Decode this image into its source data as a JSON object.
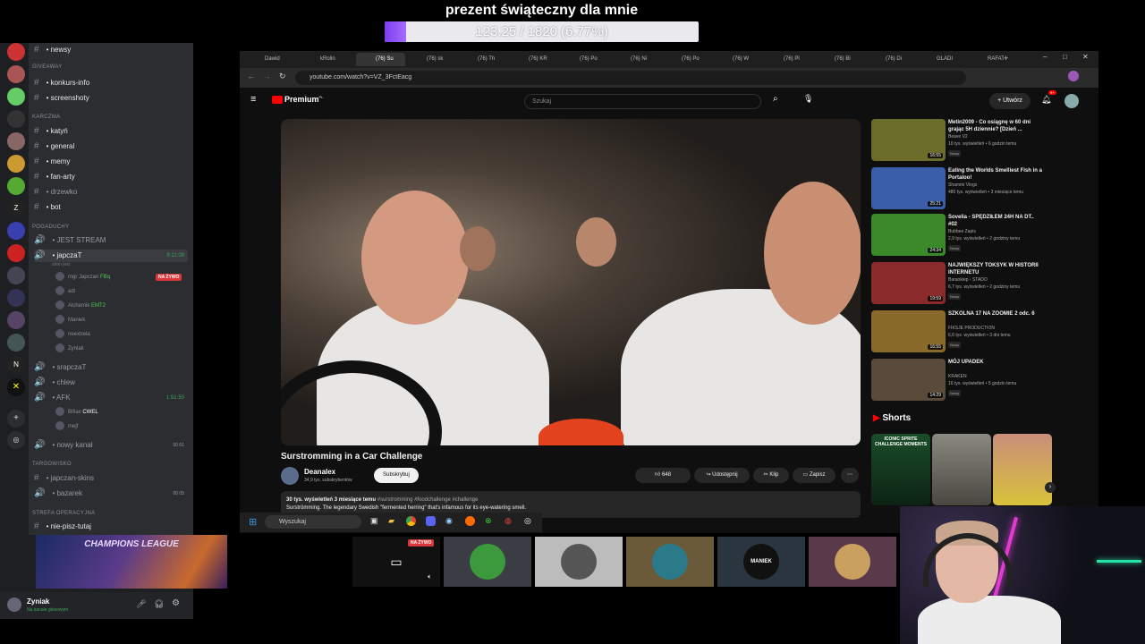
{
  "goal": {
    "title": "prezent świąteczny dla mnie",
    "progress_text": "123.25 / 1820 (6.77%)",
    "progress_fraction": 0.0677
  },
  "discord": {
    "categories": {
      "giveaway": "GIVEAWAY",
      "karczma": "KARCZMA",
      "pogaduchy": "POGADUCHY",
      "targowisko": "TARGOWISKO",
      "strefa": "STREFA OPERACYJNA"
    },
    "channels": {
      "newsy": "newsy",
      "konkurs": "konkurs-info",
      "screenshoty": "screenshoty",
      "katyn": "katyń",
      "general": "general",
      "memy": "memy",
      "fanarty": "fan-arty",
      "drzewko": "drzewko",
      "bot": "bot",
      "jest_stream": "JEST STREAM",
      "japczat": "japczaT",
      "japczat_time": "9:11:09",
      "japczat_sub": "strim jest",
      "srapczat": "srapczaT",
      "chlew": "chlew",
      "afk": "AFK",
      "afk_time": "1:51:50",
      "nowy_kanal": "nowy kanał",
      "japczan_skins": "japczan-skins",
      "bazarek": "bazarek",
      "nie_pisz": "nie-pisz-tutaj"
    },
    "voice_users": [
      "mgr Japczan",
      "adi",
      "Alchemik",
      "Maniek",
      "neextrela",
      "Zynlak"
    ],
    "afk_users": [
      "Bifiax",
      "mejf"
    ],
    "live_badge": "NA ŻYWO",
    "user_tags": {
      "mgr_japczan": "FBq",
      "alchemik": "EMT2",
      "bifiax": "CWEL"
    },
    "counters": {
      "nowy_kanal": "00 01",
      "bazarek": "00 05"
    },
    "banner_text": "CHAMPIONS LEAGUE",
    "current_user": {
      "name": "Zyniak",
      "status": "Na kanale głosowym"
    }
  },
  "browser": {
    "tabs": [
      "Dawid",
      "kRolin",
      "(76) Su",
      "(76) sk",
      "(76) Th",
      "(76) KR",
      "(76) Po",
      "(76) Ni",
      "(76) Po",
      "(76) W",
      "(76) Pl",
      "(76) Bi",
      "(76) Di",
      "GLADI",
      "RAFAT"
    ],
    "url": "youtube.com/watch?v=VZ_3FctEacg",
    "yt_logo": "Premium",
    "yt_logo_sup": "PL",
    "search_placeholder": "Szukaj",
    "create_label": "Utwórz",
    "notif_count": "9+"
  },
  "video": {
    "title": "Surstromming in a Car Challenge",
    "channel": "Deanalex",
    "subs": "34,9 tys. subskrybentów",
    "subscribe": "Subskrybuj",
    "likes": "648",
    "share": "Udostępnij",
    "clip": "Klip",
    "save": "Zapisz",
    "desc_meta": "30 tys. wyświetleń  3 miesiące temu",
    "desc_tags": "#surstromming #foodchallenge #challenge",
    "desc_text": "Surströmming. The legendary Swedish \"fermented herring\" that's infamous for its eye-watering smell."
  },
  "recommendations": [
    {
      "title": "Metin2009 - Co osiągnę w 60 dni grając 5H dziennie? [Dzień ...",
      "channel": "Beave V2",
      "meta": "10 tys. wyświetleń • 6 godzin temu",
      "badge": "Nowy",
      "duration": "16:55",
      "color": "#6b6b2a"
    },
    {
      "title": "Eating the Worlds Smelliest Fish in a Portaloo!",
      "channel": "Shammi Vlogs",
      "meta": "480 tys. wyświetleń • 3 miesiące temu",
      "badge": "",
      "duration": "25:21",
      "color": "#3a5fa8"
    },
    {
      "title": "Sovelia - SPĘDZIŁEM 24H NA DT.. #02",
      "channel": "Bubbee Zapis",
      "meta": "2,9 tys. wyświetleń • 2 godziny temu",
      "badge": "Nowy",
      "duration": "24:34",
      "color": "#3b8a2a"
    },
    {
      "title": "NAJWIĘKSZY TOKSYK W HISTORII INTERNETU",
      "channel": "Barankiep - STADO",
      "meta": "6,7 tys. wyświetleń • 2 godziny temu",
      "badge": "Nowy",
      "duration": "19:59",
      "color": "#8a2a2a"
    },
    {
      "title": "SZKOLNA 17 NA ZOOMIE 2 odc. 6",
      "channel": "FIKSJE PRODUCTION",
      "meta": "6,6 tys. wyświetleń • 3 dni temu",
      "badge": "Nowy",
      "duration": "16:55",
      "color": "#8a6a2a"
    },
    {
      "title": "MÓJ UPADEK",
      "channel": "KRAKEN",
      "meta": "16 tys. wyświetleń • 5 godzin temu",
      "badge": "Nowy",
      "duration": "14:29",
      "color": "#5a4a3a"
    }
  ],
  "shorts": {
    "heading": "Shorts",
    "first_label": "ICONIC SPRITE CHALLENGE MOMENTS"
  },
  "taskbar": {
    "search": "Wyszukaj"
  },
  "tiles": {
    "live": "NA ŻYWO",
    "maniek": "MANIEK"
  }
}
